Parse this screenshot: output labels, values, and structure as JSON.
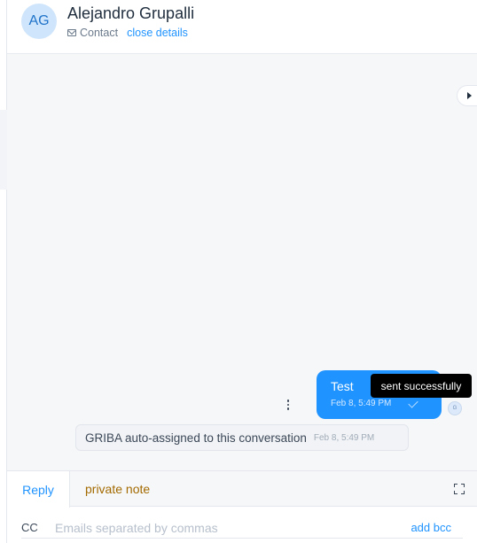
{
  "contact": {
    "initials": "AG",
    "name": "Alejandro Grupalli",
    "type": "Contact",
    "close_details": "close details"
  },
  "messages": [
    {
      "text": "Test",
      "time": "Feb 8, 5:49 PM",
      "status_tooltip": "sent successfully",
      "sender_initial": "G"
    }
  ],
  "activity": {
    "text": "GRIBA auto-assigned to this conversation",
    "time": "Feb 8, 5:49 PM"
  },
  "reply_box": {
    "tabs": [
      "Reply",
      "private note"
    ],
    "active_tab": "Reply",
    "cc_label": "CC",
    "cc_placeholder": "Emails separated by commas",
    "cc_value": "",
    "add_bcc": "add bcc"
  },
  "icons": {
    "contact_type": "mail-icon",
    "sidebar_toggle": "caret-right-icon",
    "message_status": "check-icon",
    "message_actions": "more-vertical-icon",
    "expand": "expand-icon"
  },
  "colors": {
    "accent": "#1f93ff",
    "avatar_bg": "#cfe5fb",
    "private_note": "#a36a00",
    "tooltip_bg": "#000000"
  }
}
